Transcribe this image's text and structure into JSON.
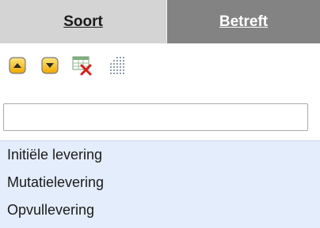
{
  "header": {
    "columns": [
      {
        "label": "Soort"
      },
      {
        "label": "Betreft"
      }
    ]
  },
  "toolbar": {
    "buttons": [
      {
        "icon": "arrow-up-icon"
      },
      {
        "icon": "arrow-down-icon"
      },
      {
        "icon": "delete-table-icon"
      },
      {
        "icon": "table-grid-icon"
      }
    ]
  },
  "search": {
    "value": "",
    "placeholder": ""
  },
  "list": {
    "items": [
      {
        "label": "Initiële levering"
      },
      {
        "label": "Mutatielevering"
      },
      {
        "label": "Opvullevering"
      }
    ]
  },
  "colors": {
    "header_active": "#d4d4d4",
    "header_inactive": "#838383",
    "list_background": "#e4edfb",
    "arrow_button": "#f5c21a"
  }
}
